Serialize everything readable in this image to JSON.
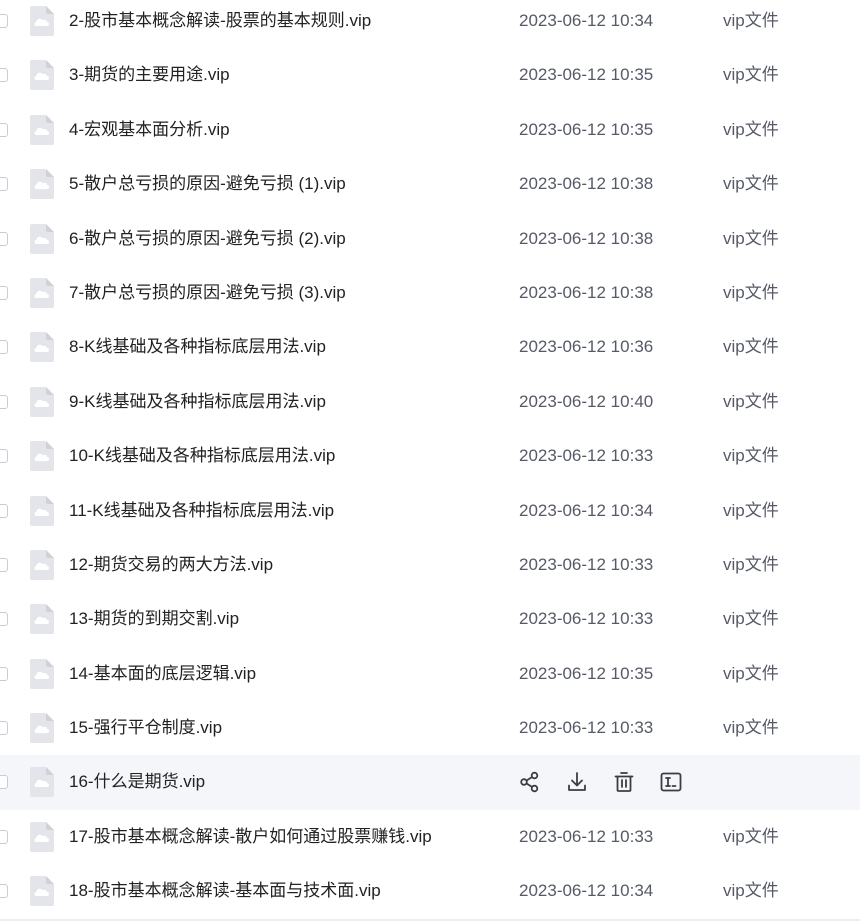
{
  "files": [
    {
      "name": "2-股市基本概念解读-股票的基本规则.vip",
      "date": "2023-06-12 10:34",
      "type": "vip文件"
    },
    {
      "name": "3-期货的主要用途.vip",
      "date": "2023-06-12 10:35",
      "type": "vip文件"
    },
    {
      "name": "4-宏观基本面分析.vip",
      "date": "2023-06-12 10:35",
      "type": "vip文件"
    },
    {
      "name": "5-散户总亏损的原因-避免亏损 (1).vip",
      "date": "2023-06-12 10:38",
      "type": "vip文件"
    },
    {
      "name": "6-散户总亏损的原因-避免亏损 (2).vip",
      "date": "2023-06-12 10:38",
      "type": "vip文件"
    },
    {
      "name": "7-散户总亏损的原因-避免亏损 (3).vip",
      "date": "2023-06-12 10:38",
      "type": "vip文件"
    },
    {
      "name": "8-K线基础及各种指标底层用法.vip",
      "date": "2023-06-12 10:36",
      "type": "vip文件"
    },
    {
      "name": "9-K线基础及各种指标底层用法.vip",
      "date": "2023-06-12 10:40",
      "type": "vip文件"
    },
    {
      "name": "10-K线基础及各种指标底层用法.vip",
      "date": "2023-06-12 10:33",
      "type": "vip文件"
    },
    {
      "name": "11-K线基础及各种指标底层用法.vip",
      "date": "2023-06-12 10:34",
      "type": "vip文件"
    },
    {
      "name": "12-期货交易的两大方法.vip",
      "date": "2023-06-12 10:33",
      "type": "vip文件"
    },
    {
      "name": "13-期货的到期交割.vip",
      "date": "2023-06-12 10:33",
      "type": "vip文件"
    },
    {
      "name": "14-基本面的底层逻辑.vip",
      "date": "2023-06-12 10:35",
      "type": "vip文件"
    },
    {
      "name": "15-强行平仓制度.vip",
      "date": "2023-06-12 10:33",
      "type": "vip文件"
    },
    {
      "name": "16-什么是期货.vip",
      "date": "",
      "type": "",
      "hovered": true
    },
    {
      "name": "17-股市基本概念解读-散户如何通过股票赚钱.vip",
      "date": "2023-06-12 10:33",
      "type": "vip文件"
    },
    {
      "name": "18-股市基本概念解读-基本面与技术面.vip",
      "date": "2023-06-12 10:34",
      "type": "vip文件"
    }
  ],
  "hover_actions": [
    "share-icon",
    "download-icon",
    "delete-icon",
    "rename-icon"
  ],
  "colors": {
    "hover_row": "#f5f6fa",
    "icon": "#e3e5ea",
    "action_icon": "#3a3d45"
  }
}
